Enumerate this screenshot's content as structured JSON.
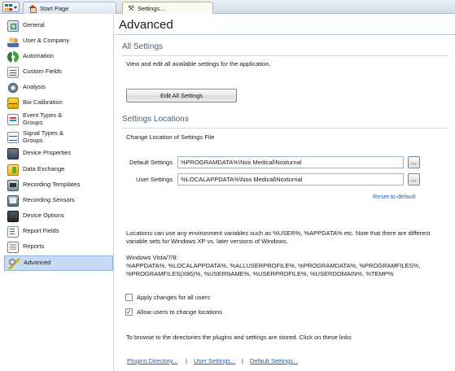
{
  "tabs": [
    {
      "label": "Start Page",
      "icon": "house-icon"
    },
    {
      "label": "Settings...",
      "icon": "tools-icon"
    }
  ],
  "sidebar": {
    "items": [
      {
        "label": "General",
        "icon": "general-icon"
      },
      {
        "label": "User & Company",
        "icon": "user-company-icon"
      },
      {
        "label": "Automation",
        "icon": "automation-icon"
      },
      {
        "label": "Custom Fields",
        "icon": "custom-fields-icon"
      },
      {
        "label": "Analysis",
        "icon": "analysis-icon"
      },
      {
        "label": "Bio Calibration",
        "icon": "bio-calibration-icon"
      },
      {
        "label": "Event Types &\nGroups",
        "icon": "event-types-icon"
      },
      {
        "label": "Signal Types &\nGroups",
        "icon": "signal-types-icon"
      },
      {
        "label": "Device Properties",
        "icon": "device-properties-icon"
      },
      {
        "label": "Data Exchange",
        "icon": "data-exchange-icon"
      },
      {
        "label": "Recording Templates",
        "icon": "recording-templates-icon"
      },
      {
        "label": "Recording Sensors",
        "icon": "recording-sensors-icon"
      },
      {
        "label": "Device Options",
        "icon": "device-options-icon"
      },
      {
        "label": "Report Fields",
        "icon": "report-fields-icon"
      },
      {
        "label": "Reports",
        "icon": "reports-icon"
      },
      {
        "label": "Advanced",
        "icon": "advanced-icon",
        "selected": true
      }
    ]
  },
  "main": {
    "title": "Advanced",
    "all_settings": {
      "heading": "All Settings",
      "description": "View and edit all available settings for the application.",
      "button_label": "Edit All Settings"
    },
    "locations": {
      "heading": "Settings Locations",
      "subheading": "Change Location of Settings File",
      "default_label": "Default Settings",
      "default_value": "%PROGRAMDATA%\\Nox Medical\\Noxturnal",
      "user_label": "User Settings",
      "user_value": "%LOCALAPPDATA%\\Nox Medical\\Noxturnal",
      "browse_label": "...",
      "reset_link": "Reset to default"
    },
    "env_info": {
      "line1": "Locations can use any environment variables such as %USER%, %APPDATA% etc. Note that there are different",
      "line2": "variable sets for Windows XP vs. later versions of Windows.",
      "vista_title": "Windows Vista/7/8:",
      "vista_line1": "%APPDATA%, %LOCALAPPDATA%, %ALLUSERPROFILE%, %PROGRAMDATA%, %PROGRAMFILES%,",
      "vista_line2": "%PROGRAMFILES(X86)%, %USERNAME%, %USERPROFILE%, %USERDOMAIN%, %TEMP%"
    },
    "checkboxes": {
      "apply_all": {
        "label": "Apply changes for all users",
        "checked": false
      },
      "allow_change": {
        "label": "Allow users to change locations",
        "checked": true
      }
    },
    "browse_text": "To browse to the directories the plugins and settings are stored. Click on these links",
    "links": {
      "plugins": "Plugins Directory...",
      "user": "User Settings...",
      "default": "Default Settings...",
      "separator": "|"
    }
  },
  "colors": {
    "link": "#1f5fbf",
    "selection_bg": "#c7dbf5",
    "section_heading": "#4f5d6f"
  }
}
